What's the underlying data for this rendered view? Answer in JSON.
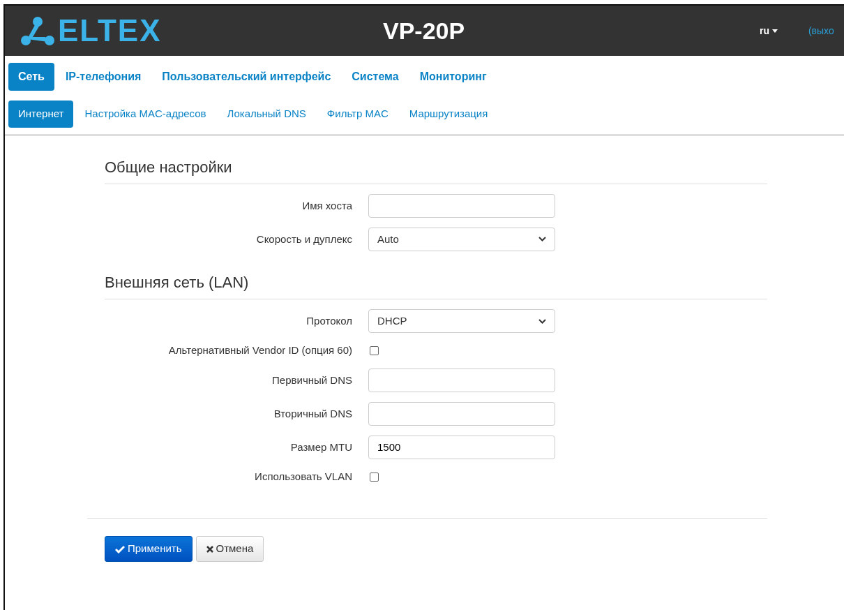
{
  "header": {
    "logo_text": "ELTEX",
    "title": "VP-20P",
    "language": "ru",
    "logout": "(выхо"
  },
  "main_tabs": [
    {
      "label": "Сеть",
      "selected": true
    },
    {
      "label": "IP-телефония",
      "selected": false
    },
    {
      "label": "Пользовательский интерфейс",
      "selected": false
    },
    {
      "label": "Система",
      "selected": false
    },
    {
      "label": "Мониторинг",
      "selected": false
    }
  ],
  "sub_tabs": [
    {
      "label": "Интернет",
      "selected": true
    },
    {
      "label": "Настройка MAC-адресов",
      "selected": false
    },
    {
      "label": "Локальный DNS",
      "selected": false
    },
    {
      "label": "Фильтр MAC",
      "selected": false
    },
    {
      "label": "Маршрутизация",
      "selected": false
    }
  ],
  "sections": [
    {
      "title": "Общие настройки",
      "fields": [
        {
          "kind": "text",
          "label": "Имя хоста"
        },
        {
          "kind": "select",
          "label": "Скорость и дуплекс",
          "value": "Auto"
        }
      ]
    },
    {
      "title": "Внешняя сеть (LAN)",
      "fields": [
        {
          "kind": "select",
          "label": "Протокол",
          "value": "DHCP"
        },
        {
          "kind": "checkbox",
          "label": "Альтернативный Vendor ID (опция 60)",
          "checked": false
        },
        {
          "kind": "text",
          "label": "Первичный DNS"
        },
        {
          "kind": "text",
          "label": "Вторичный DNS"
        },
        {
          "kind": "text",
          "label": "Размер MTU",
          "value": "1500"
        },
        {
          "kind": "checkbox",
          "label": "Использовать VLAN",
          "checked": false
        }
      ]
    }
  ],
  "buttons": [
    {
      "kind": "apply",
      "label": "Применить"
    },
    {
      "kind": "cancel",
      "label": "Отмена"
    }
  ]
}
